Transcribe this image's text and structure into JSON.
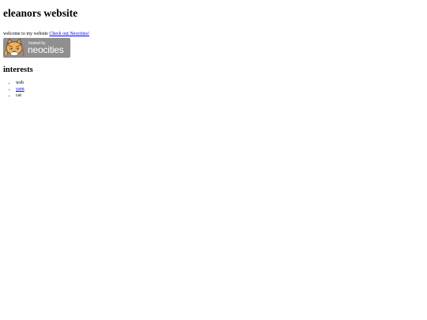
{
  "page": {
    "title": "eleanors website",
    "intro_text": "welcome to my website ",
    "intro_link": "Check out Neocities!"
  },
  "badge": {
    "hosted_text": "hosted by",
    "brand_text": "neocities",
    "icon": "neocities-cat-icon",
    "background_color": "#8f8f8f"
  },
  "interests": {
    "heading": "interests",
    "items": [
      {
        "label": "web",
        "is_link": false
      },
      {
        "label": "yarn",
        "is_link": true
      },
      {
        "label": "cat",
        "is_link": false
      }
    ]
  },
  "colors": {
    "link": "#0000ee",
    "text": "#000000",
    "background": "#ffffff"
  }
}
